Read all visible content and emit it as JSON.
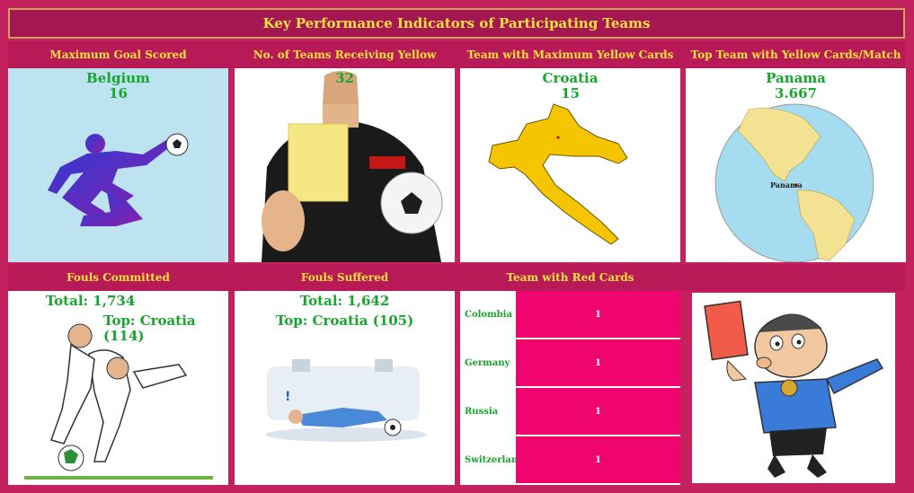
{
  "header": {
    "title": "Key Performance Indicators of Participating Teams"
  },
  "kpis": {
    "max_goals": {
      "title": "Maximum Goal Scored",
      "team": "Belgium",
      "value": "16"
    },
    "yellow_teams": {
      "title": "No. of Teams Receiving Yellow Cards",
      "value": "32"
    },
    "max_yellow": {
      "title": "Team with Maximum Yellow Cards",
      "team": "Croatia",
      "value": "15"
    },
    "yellow_per_match": {
      "title": "Top Team with Yellow Cards/Match",
      "team": "Panama",
      "value": "3.667",
      "map_label": "Panama"
    },
    "fouls_committed": {
      "title": "Fouls Committed",
      "total": "Total: 1,734",
      "top": "Top: Croatia (114)"
    },
    "fouls_suffered": {
      "title": "Fouls Suffered",
      "total": "Total: 1,642",
      "top": "Top: Croatia (105)"
    },
    "red_cards": {
      "title": "Team with Red Cards",
      "rows": [
        {
          "team": "Colombia",
          "count": "1"
        },
        {
          "team": "Germany",
          "count": "1"
        },
        {
          "team": "Russia",
          "count": "1"
        },
        {
          "team": "Switzerland",
          "count": "1"
        }
      ]
    }
  },
  "colors": {
    "background": "#c4215f",
    "title_text": "#ffe43a",
    "value_text": "#17a52c",
    "bar": "#f0056e"
  }
}
